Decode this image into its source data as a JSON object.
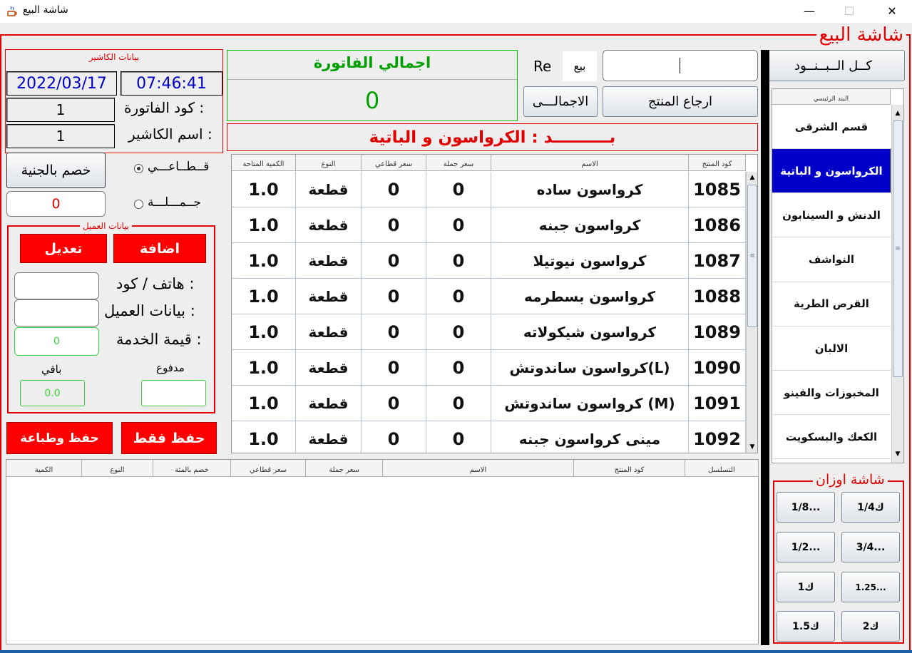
{
  "window": {
    "title": "شاشة البيع",
    "minimize": "—",
    "maximize": "☐",
    "close": "✕"
  },
  "main_legend": "شاشة البيع",
  "cashier": {
    "legend": "بيانات الكاشير",
    "date": "2022/03/17",
    "time": "07:46:41",
    "invoice_code_label": "كود الفاتورة :",
    "invoice_code": "1",
    "cashier_name_label": "اسم الكاشير :",
    "cashier_name": "1"
  },
  "invoice_total": {
    "title": "اجمالي  الفاتورة",
    "value": "0"
  },
  "top_controls": {
    "re_label": "Re",
    "sale_label": "بيع",
    "search_value": "",
    "all_items_button": "كــل الــبــنــود",
    "total_button": "الاجمالـــى",
    "return_button": "ارجاع المنتج"
  },
  "category_banner": "بــــــــــد : الكرواسون و الباتية",
  "discount": {
    "button": "خصم بالجنية",
    "value": "0",
    "retail_label": "قــطــاعـــي",
    "wholesale_label": "جــمـــلـــة",
    "price_mode": "retail"
  },
  "customer": {
    "legend": "بيانات العميل",
    "add_button": "اضافة",
    "edit_button": "تعديل",
    "phone_label": "هاتف / كود :",
    "phone_value": "",
    "customer_label": "بيانات العميل :",
    "customer_value": "",
    "service_label": "قيمة الخدمة :",
    "service_value": "0",
    "paid_label": "مدفوع",
    "paid_value": "",
    "remaining_label": "باقي",
    "remaining_value": "0.0"
  },
  "actions": {
    "save_only": "حفظ فقط",
    "save_print": "حفظ وطباعة"
  },
  "products_table": {
    "headers": [
      "كود المنتج",
      "الاسم",
      "سعر جملة",
      "سعر قطاعي",
      "النوع",
      "الكمية المتاحة"
    ],
    "rows": [
      {
        "code": "1085",
        "name": "كرواسون ساده",
        "wholesale": "0",
        "retail": "0",
        "type": "قطعة",
        "qty": "1.0"
      },
      {
        "code": "1086",
        "name": "كرواسون جبنه",
        "wholesale": "0",
        "retail": "0",
        "type": "قطعة",
        "qty": "1.0"
      },
      {
        "code": "1087",
        "name": "كرواسون نيوتيلا",
        "wholesale": "0",
        "retail": "0",
        "type": "قطعة",
        "qty": "1.0"
      },
      {
        "code": "1088",
        "name": "كرواسون بسطرمه",
        "wholesale": "0",
        "retail": "0",
        "type": "قطعة",
        "qty": "1.0"
      },
      {
        "code": "1089",
        "name": "كرواسون شيكولاته",
        "wholesale": "0",
        "retail": "0",
        "type": "قطعة",
        "qty": "1.0"
      },
      {
        "code": "1090",
        "name": "كرواسون ساندوتش(L)",
        "wholesale": "0",
        "retail": "0",
        "type": "قطعة",
        "qty": "1.0"
      },
      {
        "code": "1091",
        "name": "كرواسون ساندوتش (M)",
        "wholesale": "0",
        "retail": "0",
        "type": "قطعة",
        "qty": "1.0"
      },
      {
        "code": "1092",
        "name": "مينى كرواسون جبنه",
        "wholesale": "0",
        "retail": "0",
        "type": "قطعة",
        "qty": "1.0"
      }
    ]
  },
  "cart_table": {
    "headers": [
      "التسلسل",
      "كود المنتج",
      "الاسم",
      "سعر جملة",
      "سعر قطاعي",
      "خصم بالمئة",
      "النوع",
      "الكمية"
    ]
  },
  "categories": {
    "header": "البند الرئيسي",
    "items": [
      "قسم الشرقى",
      "الكرواسون و الباتية",
      "الدنش و السينابون",
      "النواشف",
      "القرص الطرية",
      "الالبان",
      "المخبوزات والفينو",
      "الكعك والبسكويت"
    ],
    "selected_index": 1
  },
  "weights": {
    "legend": "شاشة اوزان",
    "buttons": [
      "1/4ك",
      "1/8...",
      "3/4...",
      "1/2...",
      "1.25...",
      "1ك",
      "2ك",
      "1.5ك"
    ]
  },
  "colors": {
    "accent_red": "#ff0000",
    "selected_blue": "#0000c8",
    "date_blue": "#0000c8",
    "total_green": "#00a000"
  }
}
